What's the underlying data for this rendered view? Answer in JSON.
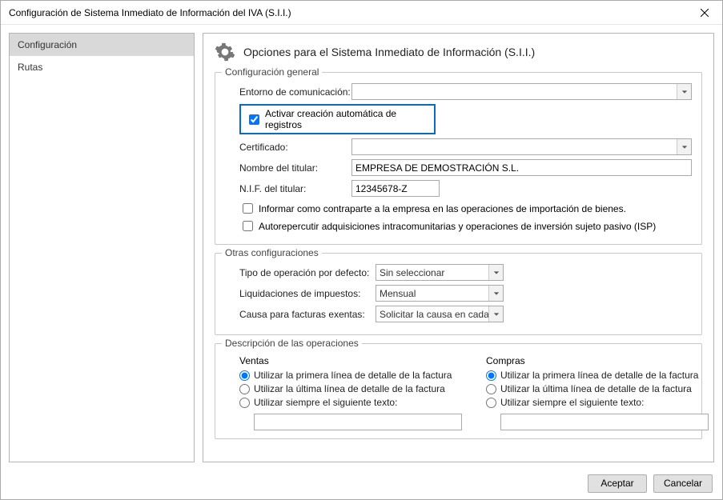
{
  "window": {
    "title": "Configuración de Sistema Inmediato de Información del IVA (S.I.I.)"
  },
  "sidebar": {
    "items": [
      {
        "label": "Configuración"
      },
      {
        "label": "Rutas"
      }
    ]
  },
  "header": {
    "title": "Opciones para el Sistema Inmediato de Información (S.I.I.)"
  },
  "general": {
    "title": "Configuración general",
    "entorno_label": "Entorno de comunicación:",
    "entorno_value": "",
    "activar_label": "Activar creación automática de registros",
    "certificado_label": "Certificado:",
    "certificado_value": "",
    "nombre_label": "Nombre del titular:",
    "nombre_value": "EMPRESA DE DEMOSTRACIÓN S.L.",
    "nif_label": "N.I.F. del titular:",
    "nif_value": "12345678-Z",
    "informar_label": "Informar como contraparte a la empresa en las operaciones de importación de bienes.",
    "autorepercutir_label": "Autorepercutir adquisiciones intracomunitarias y operaciones de inversión sujeto pasivo (ISP)"
  },
  "otras": {
    "title": "Otras configuraciones",
    "tipo_label": "Tipo de operación por defecto:",
    "tipo_value": "Sin seleccionar",
    "liquid_label": "Liquidaciones de impuestos:",
    "liquid_value": "Mensual",
    "causa_label": "Causa para facturas exentas:",
    "causa_value": "Solicitar la causa en cada"
  },
  "desc": {
    "title": "Descripción de las operaciones",
    "ventas_title": "Ventas",
    "compras_title": "Compras",
    "opt1": "Utilizar la primera línea de detalle de la factura",
    "opt2": "Utilizar la última línea de detalle de la factura",
    "opt3": "Utilizar siempre el siguiente texto:"
  },
  "footer": {
    "accept": "Aceptar",
    "cancel": "Cancelar"
  }
}
